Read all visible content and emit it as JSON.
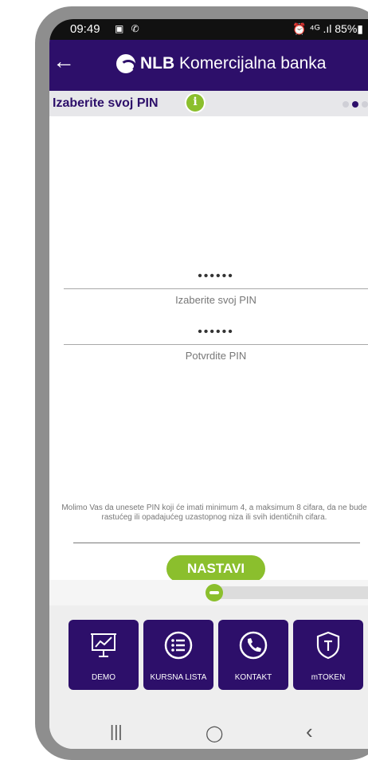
{
  "status": {
    "time": "09:49",
    "icons_left": "▣ ✆",
    "right": "⏰ ⁴ᴳ .ıl 85%▮"
  },
  "appbar": {
    "back_icon": "arrow-left-icon",
    "logo_brand": "NLB",
    "logo_rest": " Komercijalna banka"
  },
  "pinbar": {
    "title": "Izaberite svoj PIN",
    "info_icon": "info-icon"
  },
  "form": {
    "pin_value": "••••••",
    "pin_label": "Izaberite svoj PIN",
    "confirm_value": "••••••",
    "confirm_label": "Potvrdite PIN"
  },
  "note": "Molimo Vas da unesete PIN koji će imati minimum 4, a maksimum 8 cifara, da ne bude rastućeg ili opadajućeg uzastopnog niza ili svih identičnih cifara.",
  "button_next": "NASTAVI",
  "tiles": [
    {
      "label": "DEMO",
      "icon": "presentation-chart-icon"
    },
    {
      "label": "KURSNA LISTA",
      "icon": "list-icon"
    },
    {
      "label": "KONTAKT",
      "icon": "phone-icon"
    },
    {
      "label": "mTOKEN",
      "icon": "shield-token-icon"
    }
  ],
  "navbar": {
    "recent": "|||",
    "home": "◯",
    "back": "‹"
  },
  "colors": {
    "primary": "#2d0f6a",
    "accent": "#8bbf2d"
  }
}
